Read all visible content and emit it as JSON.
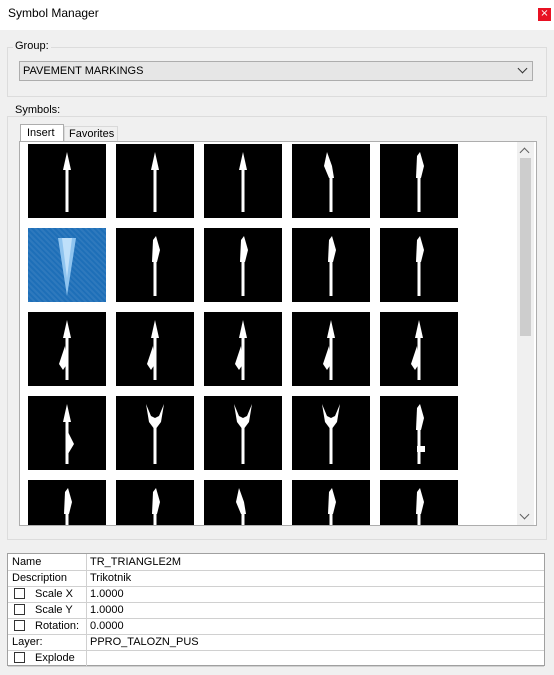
{
  "window": {
    "title": "Symbol Manager",
    "close_glyph": "×"
  },
  "group": {
    "legend": "Group:",
    "selected": "PAVEMENT MARKINGS"
  },
  "symbols": {
    "legend": "Symbols:",
    "tabs": [
      {
        "label": "Insert",
        "active": true
      },
      {
        "label": "Favorites",
        "active": false
      }
    ],
    "selected_index": 5,
    "items": [
      "arrow-straight-icon",
      "arrow-straight-icon",
      "arrow-straight-icon",
      "arrow-bend-left-icon",
      "arrow-bend-right-icon",
      "triangle-icon",
      "arrow-bend-right-icon",
      "arrow-bend-right-icon",
      "arrow-bend-right-icon",
      "arrow-bend-right-icon",
      "arrow-straight-left-icon",
      "arrow-straight-left-icon",
      "arrow-straight-left-icon",
      "arrow-straight-left-icon",
      "arrow-straight-left-icon",
      "arrow-straight-right-icon",
      "arrow-double-bend-icon",
      "arrow-double-bend-icon",
      "arrow-double-bend-icon",
      "arrow-right-hook-icon",
      "arrow-bend-right-icon",
      "arrow-bend-right-icon",
      "arrow-bend-left-icon",
      "arrow-bend-right-icon",
      "arrow-bend-right-icon"
    ]
  },
  "properties": {
    "name": {
      "label": "Name",
      "value": "TR_TRIANGLE2M"
    },
    "description": {
      "label": "Description",
      "value": "Trikotnik"
    },
    "scale_x": {
      "label": "Scale X",
      "value": "1.0000",
      "checked": false
    },
    "scale_y": {
      "label": "Scale Y",
      "value": "1.0000",
      "checked": false
    },
    "rotation": {
      "label": "Rotation:",
      "value": "0.0000",
      "checked": false
    },
    "layer": {
      "label": "Layer:",
      "value": "PPRO_TALOZN_PUS"
    },
    "explode": {
      "label": "Explode",
      "value": "",
      "checked": false
    }
  },
  "colors": {
    "accent_selection": "#1e6fb8",
    "close_red": "#e81123",
    "symbol_bg": "#000000"
  }
}
